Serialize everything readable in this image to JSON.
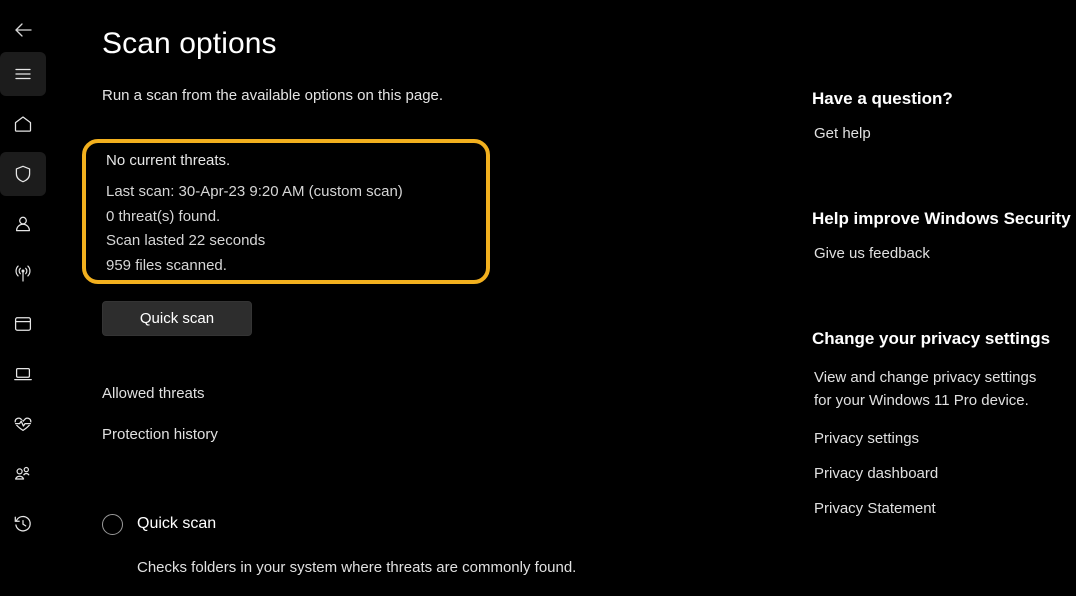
{
  "colors": {
    "background": "#000000",
    "highlight_border": "#f2b01e",
    "button_bg": "#2d2d2d",
    "rail_active_bg": "#1c1c1c",
    "text_primary": "#ffffff",
    "text_secondary": "#e0e0e0"
  },
  "sidebar": {
    "back_icon": "back-arrow-icon",
    "items": [
      {
        "icon": "hamburger-menu-icon",
        "name": "menu",
        "active": true
      },
      {
        "icon": "home-icon",
        "name": "home",
        "active": false
      },
      {
        "icon": "shield-icon",
        "name": "virus-threat-protection",
        "active": true
      },
      {
        "icon": "person-icon",
        "name": "account-protection",
        "active": false
      },
      {
        "icon": "wifi-signal-icon",
        "name": "firewall-network-protection",
        "active": false
      },
      {
        "icon": "browser-window-icon",
        "name": "app-browser-control",
        "active": false
      },
      {
        "icon": "laptop-icon",
        "name": "device-security",
        "active": false
      },
      {
        "icon": "heart-pulse-icon",
        "name": "device-performance-health",
        "active": false
      },
      {
        "icon": "family-people-icon",
        "name": "family-options",
        "active": false
      },
      {
        "icon": "history-clock-icon",
        "name": "protection-history",
        "active": false
      }
    ]
  },
  "page": {
    "title": "Scan options",
    "subtitle": "Run a scan from the available options on this page."
  },
  "status": {
    "headline": "No current threats.",
    "lines": [
      "Last scan: 30-Apr-23 9:20 AM (custom scan)",
      "0 threat(s) found.",
      "Scan lasted 22 seconds",
      "959 files scanned."
    ]
  },
  "actions": {
    "quick_scan_button": "Quick scan",
    "allowed_threats": "Allowed threats",
    "protection_history": "Protection history"
  },
  "scan_option": {
    "label": "Quick scan",
    "description": "Checks folders in your system where threats are commonly found.",
    "selected": false
  },
  "right_column": {
    "question_heading": "Have a question?",
    "get_help_link": "Get help",
    "improve_heading": "Help improve Windows Security",
    "feedback_link": "Give us feedback",
    "privacy_heading": "Change your privacy settings",
    "privacy_body_line1": "View and change privacy settings",
    "privacy_body_line2": "for your Windows 11 Pro device.",
    "privacy_settings_link": "Privacy settings",
    "privacy_dashboard_link": "Privacy dashboard",
    "privacy_statement_link": "Privacy Statement"
  }
}
